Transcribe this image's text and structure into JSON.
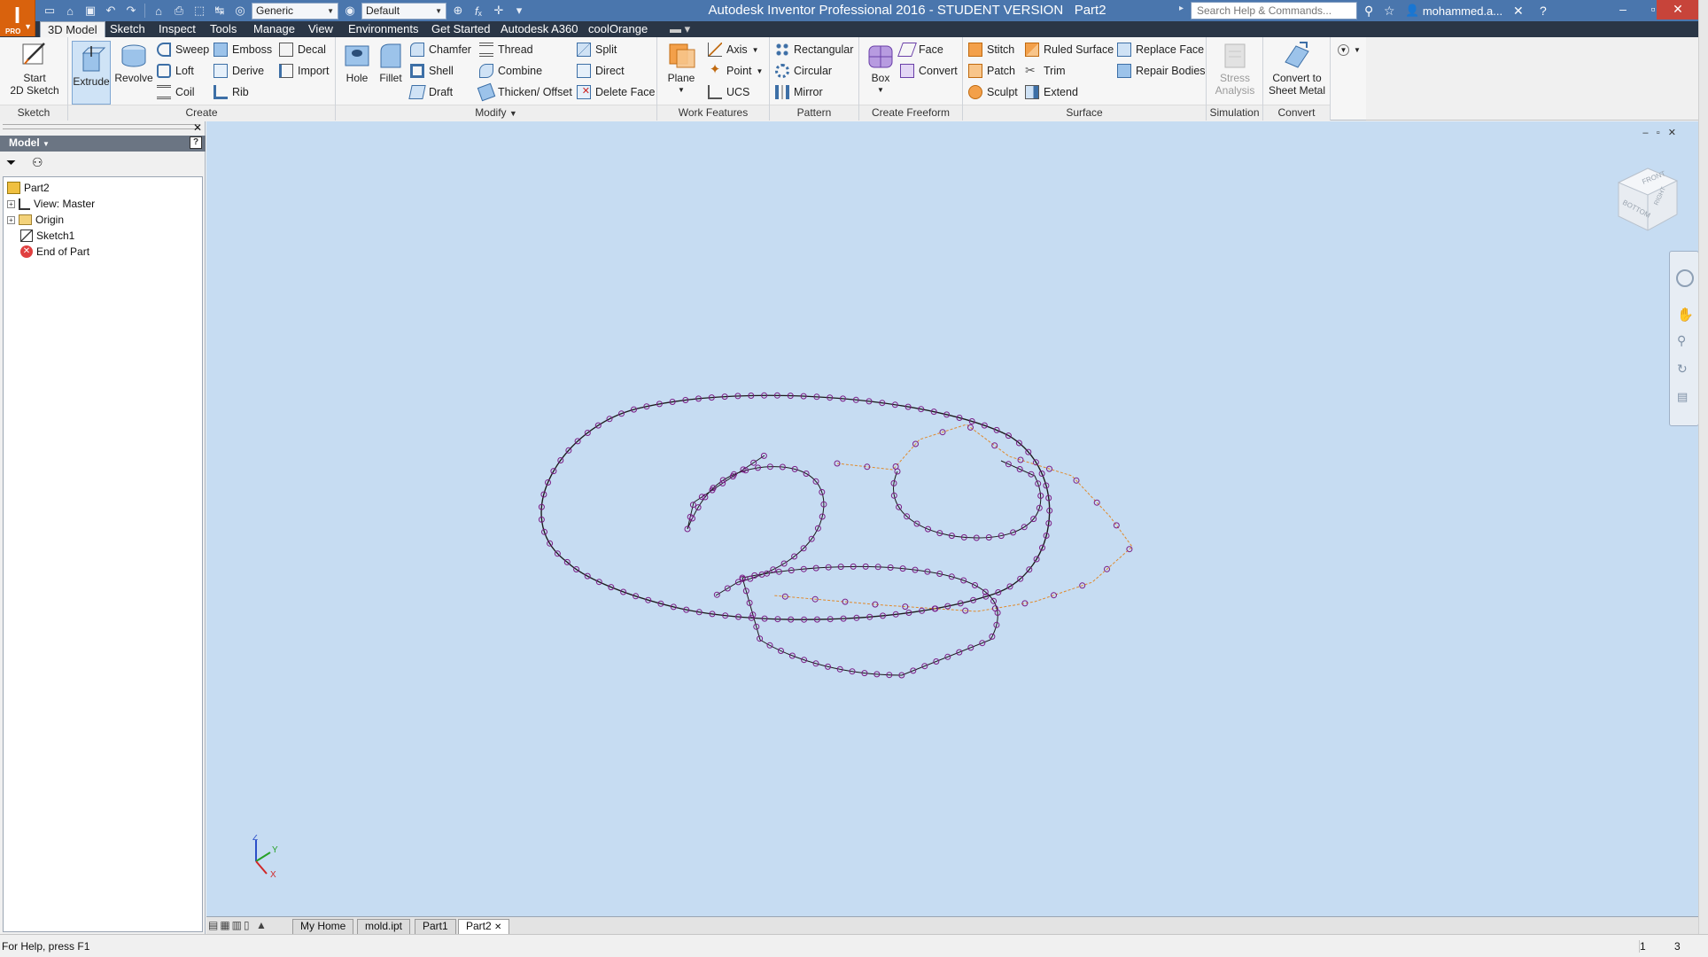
{
  "app": {
    "title": "Autodesk Inventor Professional 2016 - STUDENT VERSION",
    "document": "Part2",
    "logo_letter": "I",
    "logo_sub": "PRO"
  },
  "qat": {
    "appearance_combo": "Generic",
    "material_combo": "Default",
    "icons": [
      "new-icon",
      "open-icon",
      "save-icon",
      "undo-icon",
      "redo-icon",
      "home-icon",
      "print-icon",
      "select-icon",
      "measure-icon",
      "color-icon",
      "material-icon",
      "fx-icon",
      "more-icon"
    ]
  },
  "search": {
    "placeholder": "Search Help & Commands..."
  },
  "user": {
    "name": "mohammed.a..."
  },
  "tabs": [
    "3D Model",
    "Sketch",
    "Inspect",
    "Tools",
    "Manage",
    "View",
    "Environments",
    "Get Started",
    "Autodesk A360",
    "coolOrange"
  ],
  "ribbon": {
    "panels": {
      "sketch": "Sketch",
      "create": "Create",
      "modify": "Modify",
      "work_features": "Work Features",
      "pattern": "Pattern",
      "create_freeform": "Create Freeform",
      "surface": "Surface",
      "simulation": "Simulation",
      "convert": "Convert"
    },
    "sketch": {
      "start_2d_line1": "Start",
      "start_2d_line2": "2D Sketch"
    },
    "create": {
      "extrude": "Extrude",
      "revolve": "Revolve",
      "sweep": "Sweep",
      "loft": "Loft",
      "coil": "Coil",
      "emboss": "Emboss",
      "derive": "Derive",
      "rib": "Rib",
      "decal": "Decal",
      "import": "Import"
    },
    "modify": {
      "hole": "Hole",
      "fillet": "Fillet",
      "chamfer": "Chamfer",
      "shell": "Shell",
      "draft": "Draft",
      "thread": "Thread",
      "combine": "Combine",
      "thicken": "Thicken/ Offset",
      "split": "Split",
      "direct": "Direct",
      "delete_face": "Delete Face"
    },
    "work_features": {
      "plane": "Plane",
      "axis": "Axis",
      "point": "Point",
      "ucs": "UCS"
    },
    "pattern": {
      "rectangular": "Rectangular",
      "circular": "Circular",
      "mirror": "Mirror"
    },
    "freeform": {
      "box": "Box",
      "face": "Face",
      "convert": "Convert"
    },
    "surface": {
      "stitch": "Stitch",
      "patch": "Patch",
      "sculpt": "Sculpt",
      "ruled_surface": "Ruled Surface",
      "trim": "Trim",
      "extend": "Extend",
      "replace_face": "Replace Face",
      "repair_bodies": "Repair Bodies"
    },
    "simulation": {
      "stress_line1": "Stress",
      "stress_line2": "Analysis"
    },
    "convert": {
      "sheet_line1": "Convert to",
      "sheet_line2": "Sheet Metal"
    }
  },
  "browser": {
    "title": "Model",
    "tree": [
      {
        "label": "Part2",
        "icon": "part-icon"
      },
      {
        "label": "View: Master",
        "icon": "view-icon"
      },
      {
        "label": "Origin",
        "icon": "folder-icon"
      },
      {
        "label": "Sketch1",
        "icon": "sketch-icon"
      },
      {
        "label": "End of Part",
        "icon": "end-of-part-icon"
      }
    ]
  },
  "viewcube": {
    "front": "FRONT",
    "right": "RIGHT",
    "bottom": "BOTTOM"
  },
  "triad": {
    "x": "X",
    "y": "Y",
    "z": "Z"
  },
  "doc_tabs": [
    "My Home",
    "mold.ipt",
    "Part1",
    "Part2"
  ],
  "status": {
    "help": "For Help, press F1",
    "count1": "1",
    "count2": "3"
  },
  "colors": {
    "viewport": "#c6dcf2",
    "titlebar": "#4a76ad",
    "tabbar": "#2a3646",
    "sketch_points": "#7a1d86",
    "sketch_orange": "#e08a2b"
  }
}
